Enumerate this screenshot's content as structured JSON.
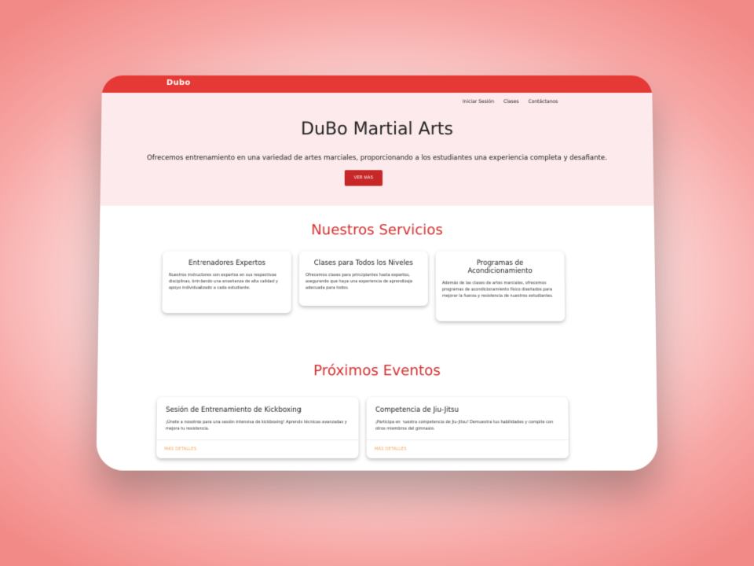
{
  "brand": "Dubo",
  "nav": {
    "items": [
      "Iniciar Sesión",
      "Clases",
      "Contáctanos"
    ]
  },
  "hero": {
    "title": "DuBo Martial Arts",
    "subtitle": "Ofrecemos entrenamiento en una variedad de artes marciales, proporcionando a los estudiantes una experiencia completa y desafiante.",
    "button_label": "VER MÁS"
  },
  "services": {
    "title": "Nuestros Servicios",
    "cards": [
      {
        "title": "Entrenadores Expertos",
        "text": "Nuestros instructores son expertos en sus respectivas disciplinas, brindando una enseñanza de alta calidad y apoyo individualizado a cada estudiante."
      },
      {
        "title": "Clases para Todos los Niveles",
        "text": "Ofrecemos clases para principiantes hasta expertos, asegurando que haya una experiencia de aprendizaje adecuada para todos."
      },
      {
        "title": "Programas de Acondicionamiento",
        "text": "Además de las clases de artes marciales, ofrecemos programas de acondicionamiento físico diseñados para mejorar la fuerza y resistencia de nuestros estudiantes."
      }
    ]
  },
  "events": {
    "title": "Próximos Eventos",
    "cards": [
      {
        "title": "Sesión de Entrenamiento de Kickboxing",
        "text": "¡Únete a nosotros para una sesión intensiva de kickboxing! Aprende técnicas avanzadas y mejora tu resistencia.",
        "link_label": "MÁS DETALLES"
      },
      {
        "title": "Competencia de Jiu-Jitsu",
        "text": "¡Participa en nuestra competencia de Jiu-Jitsu! Demuestra tus habilidades y compite con otros miembros del gimnasio.",
        "link_label": "MÁS DETALLES"
      }
    ]
  },
  "colors": {
    "primary": "#e53935",
    "button": "#c62828",
    "heading": "#d32f2f",
    "hero_bg": "#fdeaec",
    "link": "#f4a259"
  }
}
